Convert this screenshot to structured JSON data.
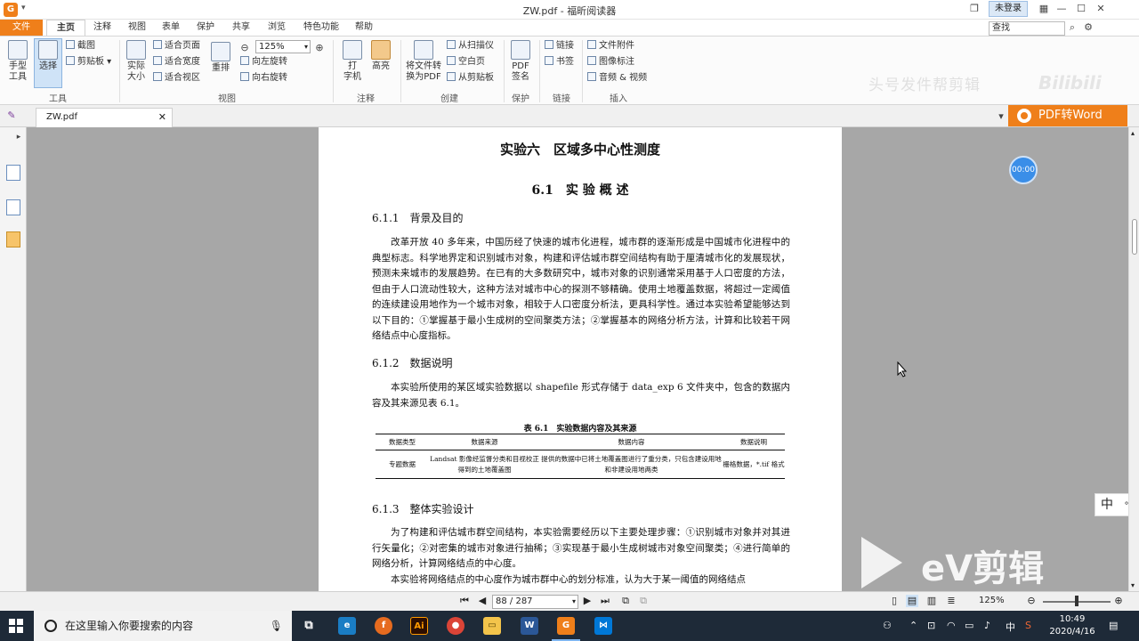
{
  "titlebar": {
    "title": "ZW.pdf - 福昕阅读器",
    "login": "未登录",
    "app_logo": "G"
  },
  "menu": {
    "items": [
      "文件",
      "主页",
      "注释",
      "视图",
      "表单",
      "保护",
      "共享",
      "浏览",
      "特色功能",
      "帮助"
    ],
    "search_placeholder": "查找"
  },
  "ribbon": {
    "hand": "手型\n工具",
    "select": "选择",
    "screenshot": "截图",
    "clipboard": "剪贴板",
    "actual_size": "实际\n大小",
    "fit_page": "适合页面",
    "fit_width": "适合宽度",
    "fit_visible": "适合视区",
    "zoom": "125%",
    "rotate_left": "向左旋转",
    "rotate_right": "向右旋转",
    "reflow": "重排",
    "typewriter": "打\n字机",
    "highlight": "高亮",
    "convert_pdf": "将文件转\n换为PDF",
    "from_scanner": "从扫描仪",
    "blank_page": "空白页",
    "from_clipboard": "从剪贴板",
    "pdf_sign": "PDF\n签名",
    "link": "链接",
    "bookmark": "书签",
    "file_attach": "文件附件",
    "image_annot": "图像标注",
    "audio_video": "音频 & 视频",
    "groups": {
      "tools": "工具",
      "view": "视图",
      "comment": "注释",
      "create": "创建",
      "protect": "保护",
      "links": "链接",
      "insert": "插入"
    },
    "watermark": "头号发件帮剪辑",
    "bili": "Bilibili"
  },
  "tabs": {
    "doc": "ZW.pdf",
    "pdf2word": "PDF转Word"
  },
  "page": {
    "title": "实验六　区域多中心性测度",
    "h1": "6.1　实 验 概 述",
    "s1": "6.1.1　背景及目的",
    "p1": "改革开放 40 多年来，中国历经了快速的城市化进程，城市群的逐渐形成是中国城市化进程中的典型标志。科学地界定和识别城市对象，构建和评估城市群空间结构有助于厘清城市化的发展现状，预测未来城市的发展趋势。在已有的大多数研究中，城市对象的识别通常采用基于人口密度的方法，但由于人口流动性较大，这种方法对城市中心的探测不够精确。使用土地覆盖数据，将超过一定阈值的连续建设用地作为一个城市对象，相较于人口密度分析法，更具科学性。通过本实验希望能够达到以下目的：①掌握基于最小生成树的空间聚类方法；②掌握基本的网络分析方法，计算和比较若干网络结点中心度指标。",
    "s2": "6.1.2　数据说明",
    "p2": "本实验所使用的某区域实验数据以 shapefile 形式存储于 data_exp 6 文件夹中，包含的数据内容及其来源见表 6.1。",
    "caption": "表 6.1　实验数据内容及其来源",
    "table_headers": [
      "数据类型",
      "数据来源",
      "数据内容",
      "数据说明"
    ],
    "table_row": [
      "专题数据",
      "Landsat 影像经监督分类和目视校正得到的土地覆盖图",
      "提供的数据中已将土地覆盖图进行了重分类，只包含建设用地和非建设用地两类",
      "栅格数据，*.tif 格式"
    ],
    "s3": "6.1.3　整体实验设计",
    "p3": "为了构建和评估城市群空间结构，本实验需要经历以下主要处理步骤：①识别城市对象并对其进行矢量化；②对密集的城市对象进行抽稀；③实现基于最小生成树城市对象空间聚类；④进行简单的网络分析，计算网络结点的中心度。",
    "p4": "本实验将网络结点的中心度作为城市群中心的划分标准，认为大于某一阈值的网络结点"
  },
  "overlay": {
    "timer": "00:00",
    "ime": "中",
    "ime2": "°,",
    "ev": "eV剪辑"
  },
  "statusbar": {
    "page": "88 / 287",
    "zoom": "125%"
  },
  "taskbar": {
    "search": "在这里输入你要搜索的内容",
    "time": "10:49",
    "date": "2020/4/16",
    "lang": "中"
  }
}
